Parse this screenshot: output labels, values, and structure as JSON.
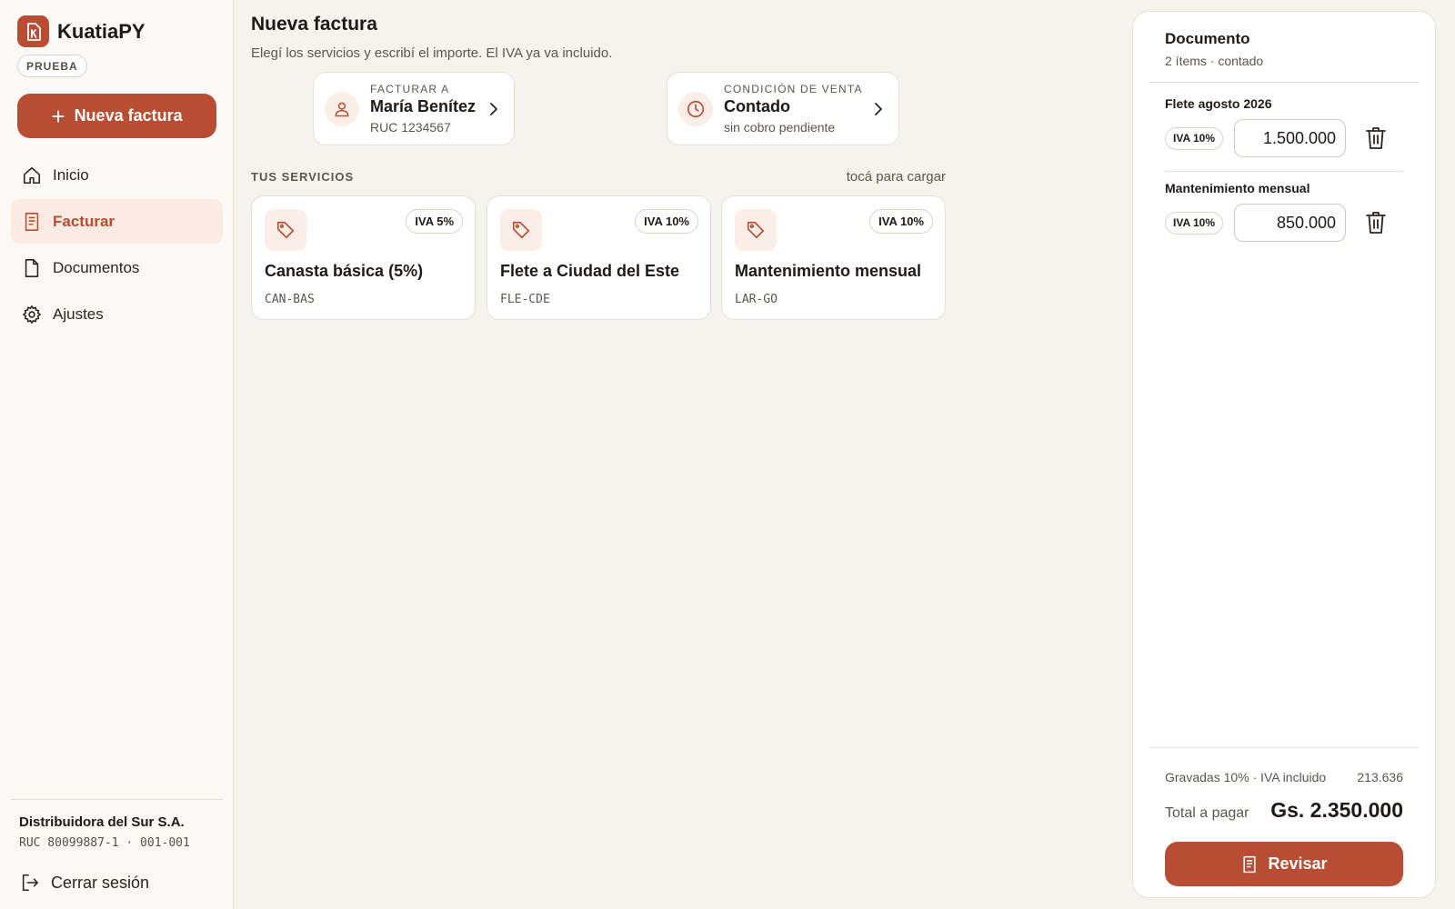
{
  "brand": {
    "name": "KuatiaPY",
    "env_badge": "PRUEBA"
  },
  "sidebar": {
    "new_invoice_label": "Nueva factura",
    "items": [
      {
        "label": "Inicio",
        "icon": "home-icon",
        "active": false
      },
      {
        "label": "Facturar",
        "icon": "receipt-icon",
        "active": true
      },
      {
        "label": "Documentos",
        "icon": "document-icon",
        "active": false
      },
      {
        "label": "Ajustes",
        "icon": "gear-icon",
        "active": false
      }
    ],
    "company": {
      "name": "Distribuidora del Sur S.A.",
      "ruc": "RUC 80099887-1 · 001-001"
    },
    "logout_label": "Cerrar sesión"
  },
  "main": {
    "title": "Nueva factura",
    "subtitle": "Elegí los servicios y escribí el importe. El IVA ya va incluido.",
    "bill_to": {
      "eyebrow": "FACTURAR A",
      "name": "María Benítez",
      "ruc": "RUC 1234567"
    },
    "sale_condition": {
      "eyebrow": "CONDICIÓN DE VENTA",
      "value": "Contado",
      "detail": "sin cobro pendiente"
    },
    "services_label": "TUS SERVICIOS",
    "services_hint": "tocá para cargar",
    "services": [
      {
        "name": "Canasta básica (5%)",
        "code": "CAN-BAS",
        "iva": "IVA 5%"
      },
      {
        "name": "Flete a Ciudad del Este",
        "code": "FLE-CDE",
        "iva": "IVA 10%"
      },
      {
        "name": "Mantenimiento mensual",
        "code": "LAR-GO",
        "iva": "IVA 10%"
      }
    ]
  },
  "document": {
    "title": "Documento",
    "meta": "2 ítems · contado",
    "items": [
      {
        "name": "Flete agosto 2026",
        "iva": "IVA 10%",
        "amount": "1.500.000"
      },
      {
        "name": "Mantenimiento mensual",
        "iva": "IVA 10%",
        "amount": "850.000"
      }
    ],
    "tax_label": "Gravadas 10% · IVA incluido",
    "tax_value": "213.636",
    "total_label": "Total a pagar",
    "total_value": "Gs. 2.350.000",
    "review_label": "Revisar"
  },
  "colors": {
    "accent": "#b94d33",
    "accent_soft": "#fcebe3",
    "background": "#f5f3ec",
    "sidebar": "#faf9f5"
  }
}
